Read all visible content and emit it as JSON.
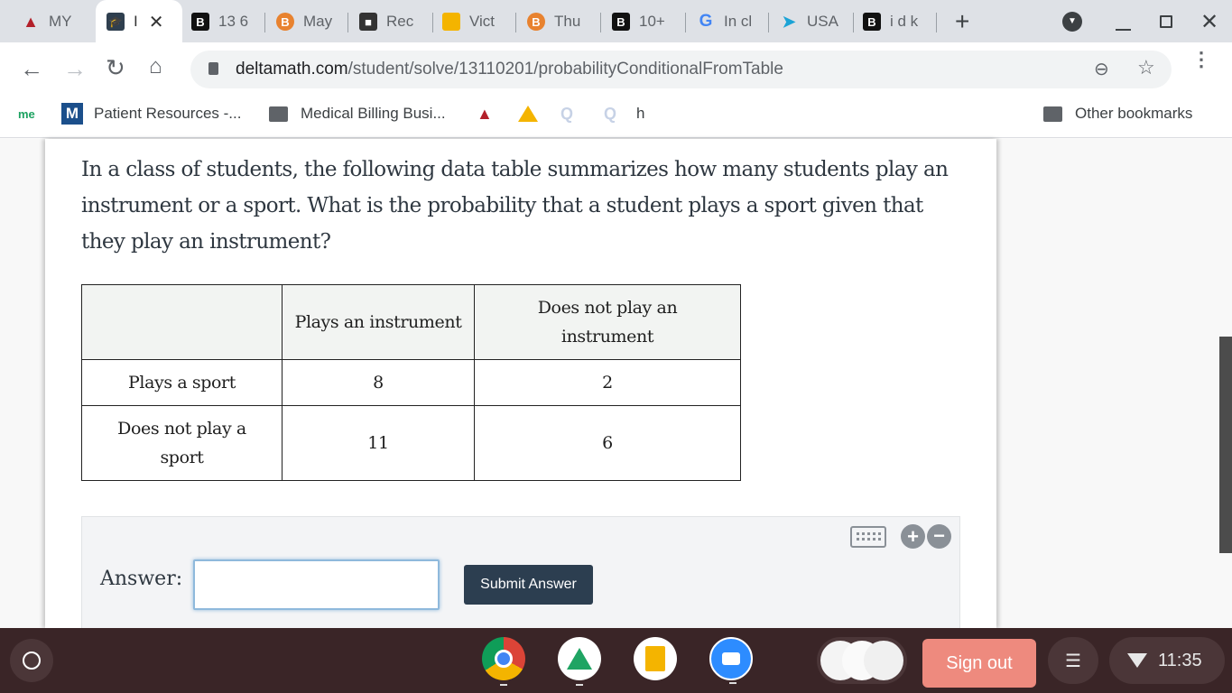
{
  "browser": {
    "tabs": [
      {
        "label": "MY",
        "icon": "torch-icon",
        "active": false
      },
      {
        "label": "I",
        "icon": "graduation-cap-icon",
        "active": true
      },
      {
        "label": "13 6",
        "icon": "brainly-b-icon",
        "active": false
      },
      {
        "label": "May",
        "icon": "bitcoin-b-icon",
        "active": false
      },
      {
        "label": "Rec",
        "icon": "contact-card-icon",
        "active": false
      },
      {
        "label": "Vict",
        "icon": "slides-icon",
        "active": false
      },
      {
        "label": "Thu",
        "icon": "bitcoin-b-icon",
        "active": false
      },
      {
        "label": "10+",
        "icon": "brainly-b-icon",
        "active": false
      },
      {
        "label": "In cl",
        "icon": "google-g-icon",
        "active": false
      },
      {
        "label": "USA",
        "icon": "cursor-arrow-icon",
        "active": false
      },
      {
        "label": "i d k",
        "icon": "brainly-b-icon",
        "active": false
      }
    ],
    "new_tab_label": "+",
    "url_domain": "deltamath.com",
    "url_path": "/student/solve/13110201/probabilityConditionalFromTable",
    "bookmarks": [
      {
        "label": "",
        "icon": "me-icon"
      },
      {
        "label": "Patient Resources -...",
        "icon": "m-logo-icon"
      },
      {
        "label": "Medical Billing Busi...",
        "icon": "folder-icon"
      },
      {
        "label": "",
        "icon": "torch-icon"
      },
      {
        "label": "",
        "icon": "google-drive-icon"
      },
      {
        "label": "",
        "icon": "q-icon"
      },
      {
        "label": "",
        "icon": "q-icon"
      },
      {
        "label": "h",
        "icon": ""
      }
    ],
    "other_bookmarks_label": "Other bookmarks"
  },
  "problem": {
    "question": "In a class of students, the following data table summarizes how many students play an instrument or a sport. What is the probability that a student plays a sport given that they play an instrument?",
    "table": {
      "headers": [
        "",
        "Plays an instrument",
        "Does not play an instrument"
      ],
      "rows": [
        [
          "Plays a sport",
          "8",
          "2"
        ],
        [
          "Does not play a sport",
          "11",
          "6"
        ]
      ]
    },
    "answer_label": "Answer:",
    "answer_value": "",
    "submit_label": "Submit Answer"
  },
  "shelf": {
    "apps": [
      "chrome-icon",
      "google-drive-icon",
      "google-slides-icon",
      "zoom-icon"
    ],
    "sign_out_label": "Sign out",
    "time": "11:35"
  }
}
